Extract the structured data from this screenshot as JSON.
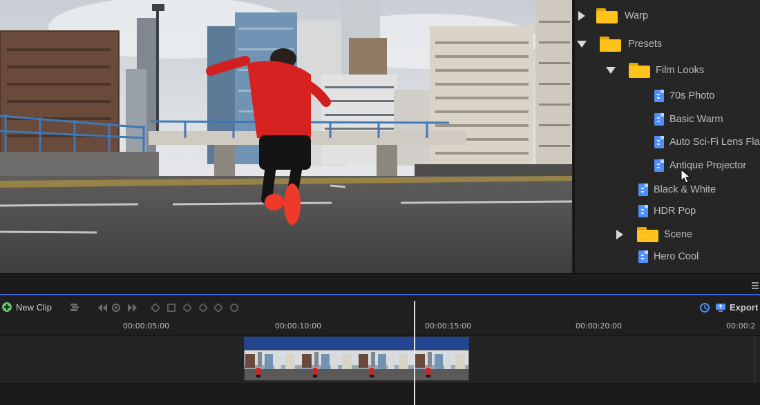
{
  "browser": {
    "items": [
      {
        "label": "Warp",
        "kind": "folder",
        "state": "collapsed",
        "level": 0
      },
      {
        "label": "Presets",
        "kind": "folder",
        "state": "expanded",
        "level": 0
      },
      {
        "label": "Film Looks",
        "kind": "folder",
        "state": "expanded",
        "level": 1
      },
      {
        "label": "70s Photo",
        "kind": "effect",
        "level": 2
      },
      {
        "label": "Basic Warm",
        "kind": "effect",
        "level": 2
      },
      {
        "label": "Auto Sci-Fi Lens Flares",
        "kind": "effect",
        "level": 2
      },
      {
        "label": "Antique Projector",
        "kind": "effect",
        "level": 2
      },
      {
        "label": "Black & White",
        "kind": "effect",
        "level": 1
      },
      {
        "label": "HDR Pop",
        "kind": "effect",
        "level": 1
      },
      {
        "label": "Scene",
        "kind": "folder",
        "state": "collapsed",
        "level": 1
      },
      {
        "label": "Hero Cool",
        "kind": "effect",
        "level": 1
      }
    ]
  },
  "toolbar": {
    "new_clip_label": "New Clip",
    "export_label": "Export",
    "icons": [
      "add-icon",
      "layers-icon",
      "previous-keyframe-icon",
      "add-keyframe-icon",
      "next-keyframe-icon",
      "clock-icon",
      "export-icon"
    ]
  },
  "ruler": {
    "timecodes": [
      "00:00:05:00",
      "00:00:10:00",
      "00:00:15:00",
      "00:00:20:00",
      "00:00:2"
    ]
  },
  "colors": {
    "accent": "#3a5fd6",
    "clip_header": "#23448f",
    "folder": "#ffc21a",
    "effect": "#4f8ff7"
  }
}
